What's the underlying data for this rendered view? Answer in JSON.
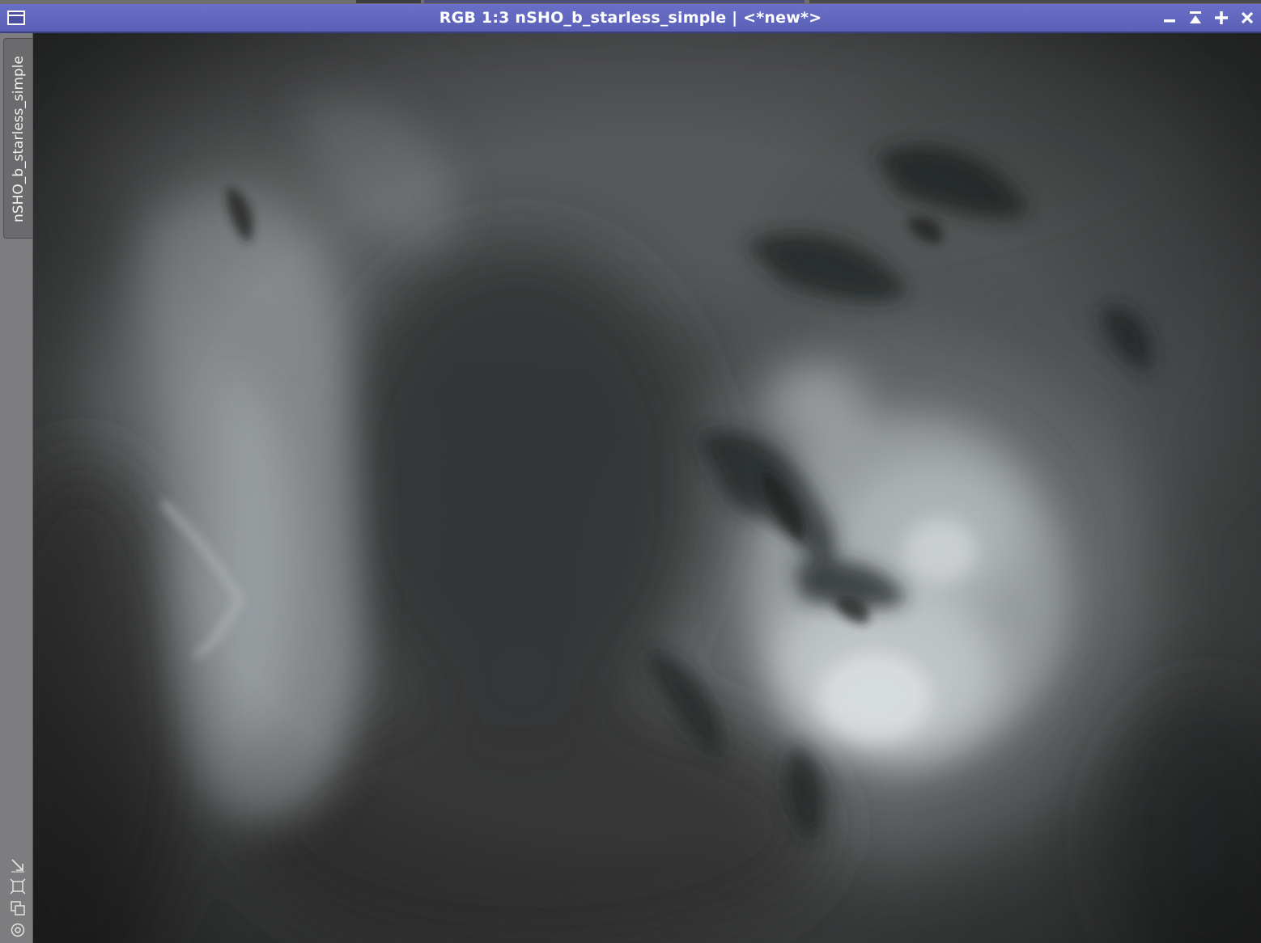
{
  "window": {
    "title": "RGB 1:3 nSHO_b_starless_simple | <*new*>",
    "titlebar_color": "#5f65bd",
    "controls": {
      "minimize_icon": "minimize-icon",
      "shade_icon": "shade-icon",
      "maximize_icon": "maximize-icon",
      "close_icon": "close-icon"
    }
  },
  "sidebar": {
    "view_tab_label": "nSHO_b_starless_simple",
    "tools": [
      "stf-arrow-icon",
      "fit-view-icon",
      "clone-view-icon",
      "identifier-icon"
    ]
  },
  "image": {
    "description_color_dark": "#3c3d3e",
    "description_color_light": "#d2d6d8"
  }
}
